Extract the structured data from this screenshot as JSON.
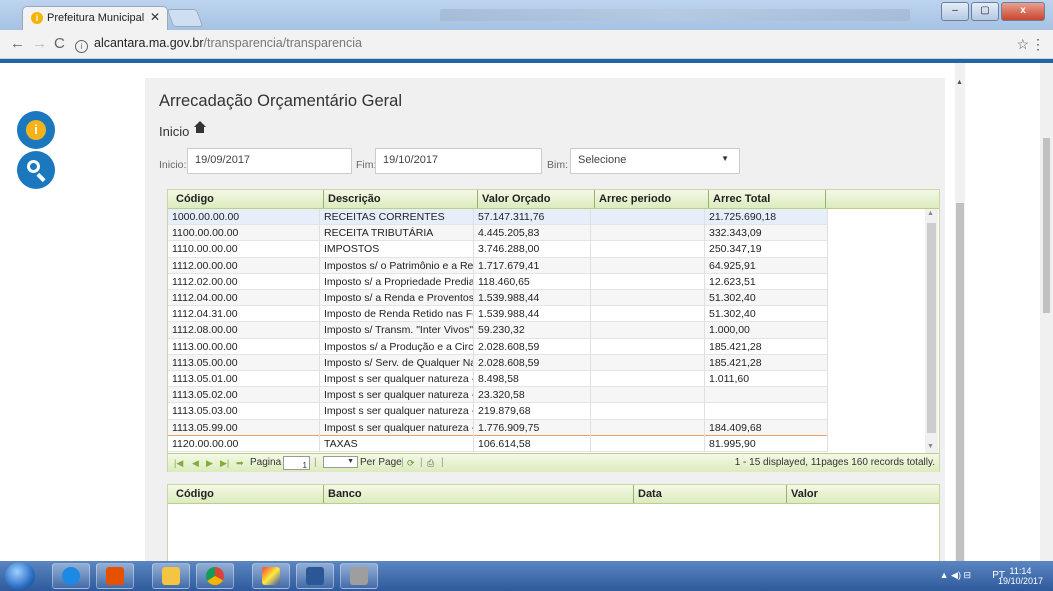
{
  "browser": {
    "tab_title": "Prefeitura Municipal de A",
    "url_host": "alcantara.ma.gov.br",
    "url_path": "/transparencia/transparencia"
  },
  "page": {
    "title": "Arrecadação Orçamentário Geral",
    "breadcrumb": "Inicio",
    "filters": {
      "inicio_label": "Inicio:",
      "inicio_value": "19/09/2017",
      "fim_label": "Fim:",
      "fim_value": "19/10/2017",
      "bim_label": "Bim:",
      "bim_value": "Selecione"
    }
  },
  "grid": {
    "columns": [
      "Código",
      "Descrição",
      "Valor Orçado",
      "Arrec periodo",
      "Arrec Total"
    ],
    "rows": [
      [
        "1000.00.00.00",
        "RECEITAS CORRENTES",
        "57.147.311,76",
        "",
        "21.725.690,18"
      ],
      [
        "1100.00.00.00",
        "RECEITA TRIBUTÁRIA",
        "4.445.205,83",
        "",
        "332.343,09"
      ],
      [
        "1110.00.00.00",
        "IMPOSTOS",
        "3.746.288,00",
        "",
        "250.347,19"
      ],
      [
        "1112.00.00.00",
        "Impostos s/ o Patrimônio e a Renda",
        "1.717.679,41",
        "",
        "64.925,91"
      ],
      [
        "1112.02.00.00",
        "Imposto s/ a Propriedade Predial ...",
        "118.460,65",
        "",
        "12.623,51"
      ],
      [
        "1112.04.00.00",
        "Imposto s/ a Renda e Proventos d...",
        "1.539.988,44",
        "",
        "51.302,40"
      ],
      [
        "1112.04.31.00",
        "Imposto de Renda Retido nas Fon...",
        "1.539.988,44",
        "",
        "51.302,40"
      ],
      [
        "1112.08.00.00",
        "Imposto s/ Transm. \"Inter Vivos\" d...",
        "59.230,32",
        "",
        "1.000,00"
      ],
      [
        "1113.00.00.00",
        "Impostos s/ a Produção e a Circul...",
        "2.028.608,59",
        "",
        "185.421,28"
      ],
      [
        "1113.05.00.00",
        "Imposto s/ Serv. de Qualquer Natu...",
        "2.028.608,59",
        "",
        "185.421,28"
      ],
      [
        "1113.05.01.00",
        "Impost s ser qualquer natureza - F...",
        "8.498,58",
        "",
        "1.011,60"
      ],
      [
        "1113.05.02.00",
        "Impost s ser qualquer natureza - F...",
        "23.320,58",
        "",
        ""
      ],
      [
        "1113.05.03.00",
        "Impost s ser qualquer natureza - F...",
        "219.879,68",
        "",
        ""
      ],
      [
        "1113.05.99.00",
        "Impost s ser qualquer natureza - ...",
        "1.776.909,75",
        "",
        "184.409,68"
      ],
      [
        "1120.00.00.00",
        "TAXAS",
        "106.614,58",
        "",
        "81.995,90"
      ]
    ],
    "pager": {
      "page_label": "Pagina",
      "page_value": "1",
      "per_page_label": "Per Page",
      "info": "1 - 15 displayed, 11pages 160 records totally."
    }
  },
  "grid2": {
    "columns": [
      "Código",
      "Banco",
      "Data",
      "Valor"
    ]
  },
  "taskbar": {
    "lang": "PT",
    "time": "11:14",
    "date": "19/10/2017"
  }
}
